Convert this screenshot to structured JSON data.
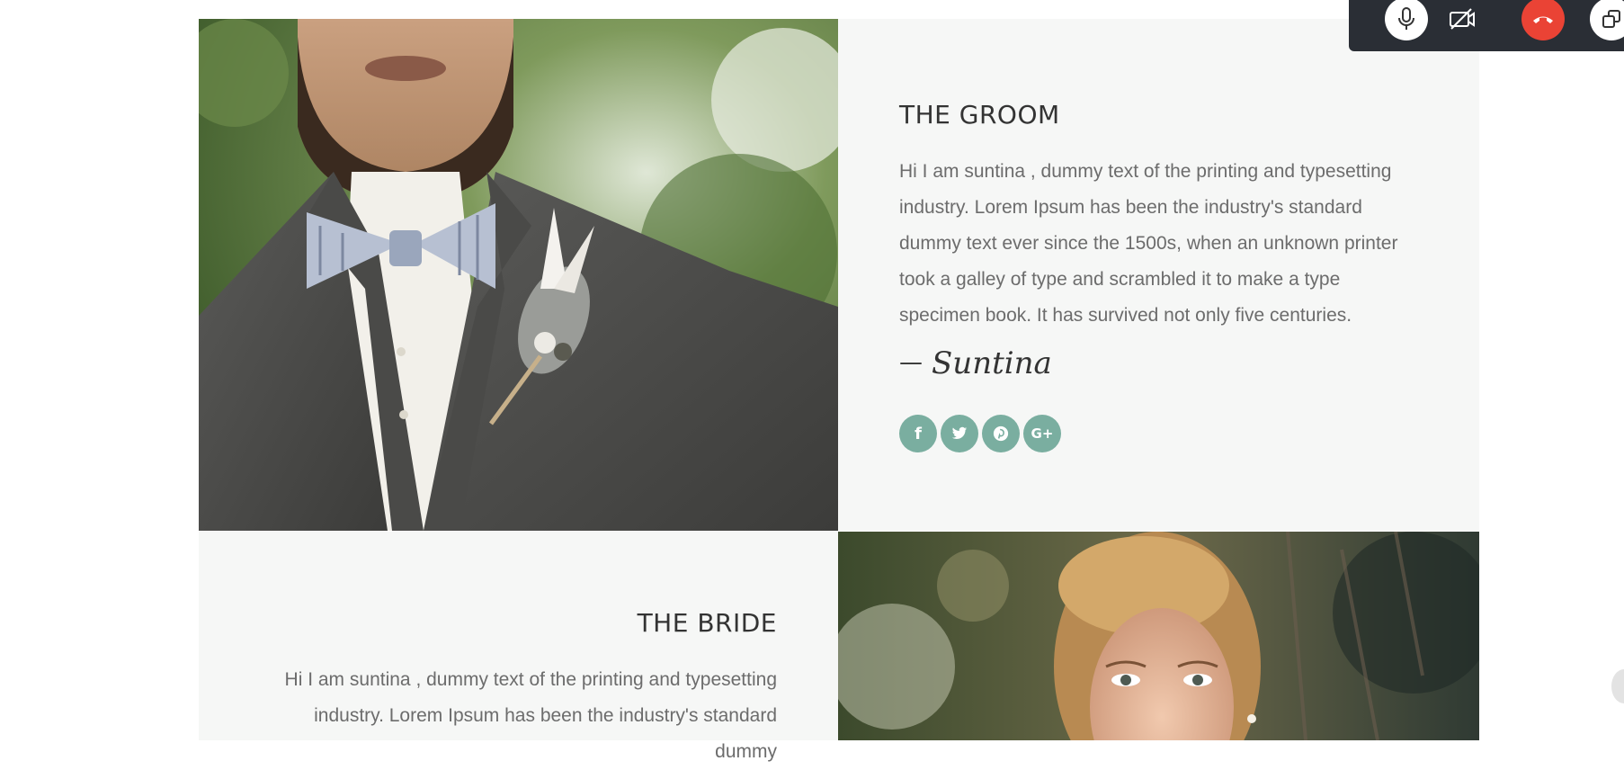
{
  "groom": {
    "title": "THE GROOM",
    "bio": "Hi I am suntina , dummy text of the printing and typesetting industry. Lorem Ipsum has been the industry's standard dummy text ever since the 1500s, when an unknown printer took a galley of type and scrambled it to make a type specimen book. It has survived not only five centuries.",
    "signature_dash": "—",
    "signature": "Suntina",
    "photo_icon": "groom-photo"
  },
  "bride": {
    "title": "THE BRIDE",
    "bio": "Hi I am suntina , dummy text of the printing and typesetting industry. Lorem Ipsum has been the industry's standard dummy",
    "photo_icon": "bride-photo"
  },
  "social": [
    {
      "icon": "facebook-icon",
      "glyph": "f"
    },
    {
      "icon": "twitter-icon",
      "glyph": "t"
    },
    {
      "icon": "pinterest-icon",
      "glyph": "p"
    },
    {
      "icon": "google-plus-icon",
      "glyph": "G+"
    }
  ],
  "call_controls": [
    {
      "icon": "microphone-icon"
    },
    {
      "icon": "camera-off-icon"
    },
    {
      "icon": "hang-up-icon"
    },
    {
      "icon": "popout-window-icon"
    }
  ],
  "colors": {
    "panel_bg": "#f6f7f6",
    "social_accent": "#7aaea0",
    "call_bar_bg": "#2a2e35",
    "hang_up_red": "#ea4335",
    "heading": "#333333",
    "body_text": "#6c6c6c"
  }
}
